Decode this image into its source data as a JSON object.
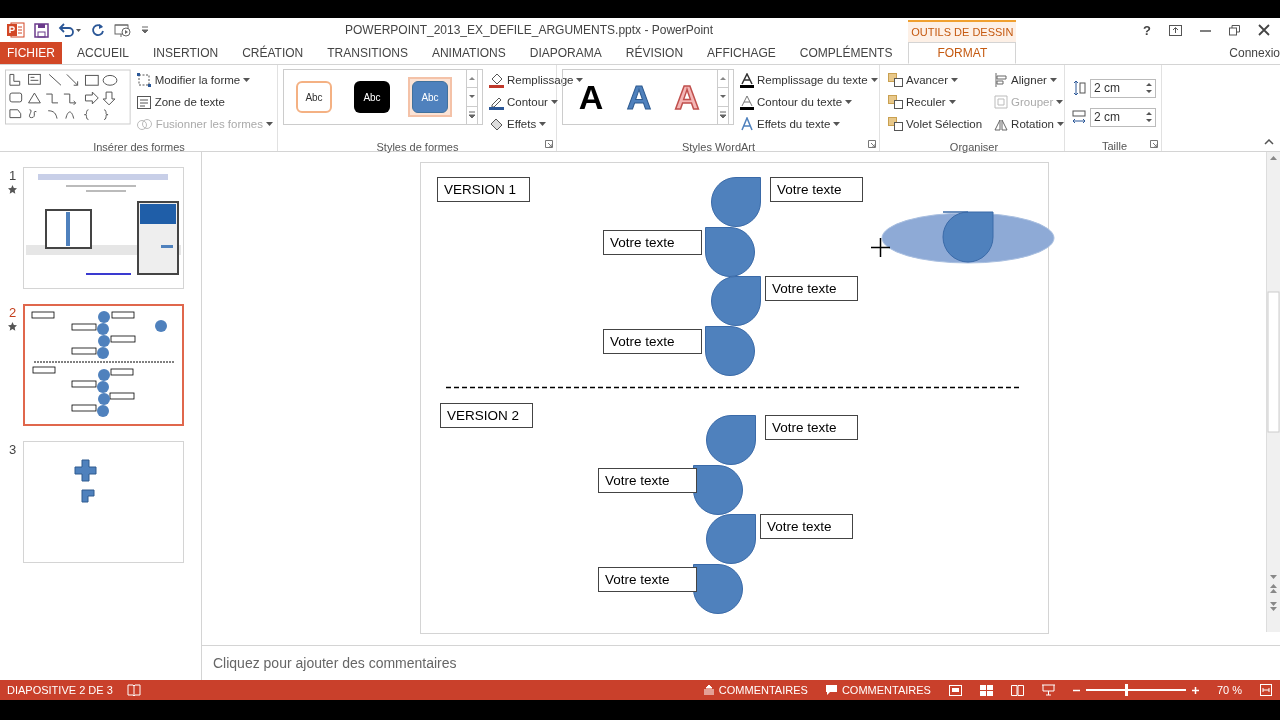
{
  "title_bar": {
    "title": "POWERPOINT_2013_EX_DEFILE_ARGUMENTS.pptx - PowerPoint",
    "help": "?"
  },
  "contextual_group": "OUTILS DE DESSIN",
  "tabs": [
    {
      "label": "FICHIER",
      "kind": "file",
      "selected": false
    },
    {
      "label": "ACCUEIL",
      "kind": "tab",
      "selected": false
    },
    {
      "label": "INSERTION",
      "kind": "tab",
      "selected": false
    },
    {
      "label": "CRÉATION",
      "kind": "tab",
      "selected": false
    },
    {
      "label": "TRANSITIONS",
      "kind": "tab",
      "selected": false
    },
    {
      "label": "ANIMATIONS",
      "kind": "tab",
      "selected": false
    },
    {
      "label": "DIAPORAMA",
      "kind": "tab",
      "selected": false
    },
    {
      "label": "RÉVISION",
      "kind": "tab",
      "selected": false
    },
    {
      "label": "AFFICHAGE",
      "kind": "tab",
      "selected": false
    },
    {
      "label": "COMPLÉMENTS",
      "kind": "tab",
      "selected": false
    },
    {
      "label": "FORMAT",
      "kind": "contextual",
      "selected": true
    }
  ],
  "account": "Connexio",
  "ribbon": {
    "insert_shapes": {
      "label": "Insérer des formes",
      "buttons": [
        {
          "label": "Modifier la forme",
          "dropdown": true,
          "disabled": false
        },
        {
          "label": "Zone de texte",
          "dropdown": false,
          "disabled": false
        },
        {
          "label": "Fusionner les formes",
          "dropdown": true,
          "disabled": true
        }
      ]
    },
    "shape_styles": {
      "label": "Styles de formes",
      "swatches": [
        {
          "label": "Abc",
          "kind": "outline",
          "selected": false
        },
        {
          "label": "Abc",
          "kind": "dark",
          "selected": false
        },
        {
          "label": "Abc",
          "kind": "filled",
          "selected": true
        }
      ],
      "buttons": [
        {
          "label": "Remplissage",
          "dropdown": true,
          "disabled": false
        },
        {
          "label": "Contour",
          "dropdown": true,
          "disabled": false
        },
        {
          "label": "Effets",
          "dropdown": true,
          "disabled": false
        }
      ]
    },
    "wordart_styles": {
      "label": "Styles WordArt",
      "swatches": [
        {
          "label": "A",
          "kind": "black"
        },
        {
          "label": "A",
          "kind": "blue"
        },
        {
          "label": "A",
          "kind": "red"
        }
      ],
      "buttons": [
        {
          "label": "Remplissage du texte",
          "dropdown": true,
          "disabled": false
        },
        {
          "label": "Contour du texte",
          "dropdown": true,
          "disabled": false
        },
        {
          "label": "Effets du texte",
          "dropdown": true,
          "disabled": false
        }
      ]
    },
    "arrange": {
      "label": "Organiser",
      "buttons": [
        {
          "label": "Avancer",
          "dropdown": true,
          "disabled": false
        },
        {
          "label": "Reculer",
          "dropdown": true,
          "disabled": false
        },
        {
          "label": "Volet Sélection",
          "dropdown": false,
          "disabled": false
        },
        {
          "label": "Aligner",
          "dropdown": true,
          "disabled": false
        },
        {
          "label": "Grouper",
          "dropdown": true,
          "disabled": true
        },
        {
          "label": "Rotation",
          "dropdown": true,
          "disabled": false
        }
      ]
    },
    "size": {
      "label": "Taille",
      "height": "2 cm",
      "width": "2 cm"
    }
  },
  "slides": [
    {
      "number": "1",
      "starred": true,
      "selected": false
    },
    {
      "number": "2",
      "starred": true,
      "selected": true
    },
    {
      "number": "3",
      "starred": false,
      "selected": false
    }
  ],
  "slide": {
    "sections": [
      {
        "label": "VERSION 1",
        "steps": [
          {
            "text": "Votre texte"
          },
          {
            "text": "Votre texte"
          },
          {
            "text": "Votre texte"
          },
          {
            "text": "Votre texte"
          }
        ]
      },
      {
        "label": "VERSION 2",
        "steps": [
          {
            "text": "Votre texte"
          },
          {
            "text": "Votre texte"
          },
          {
            "text": "Votre texte"
          },
          {
            "text": "Votre texte"
          }
        ]
      }
    ],
    "selected_shape": {
      "kind": "ellipse",
      "selected": true
    }
  },
  "notes": {
    "placeholder": "Cliquez pour ajouter des commentaires"
  },
  "status_bar": {
    "slide_info": "DIAPOSITIVE 2 DE 3",
    "notes_button": "COMMENTAIRES",
    "comments_button": "COMMENTAIRES",
    "zoom": "70 %",
    "zoom_slider": {
      "level": 0.4
    }
  }
}
